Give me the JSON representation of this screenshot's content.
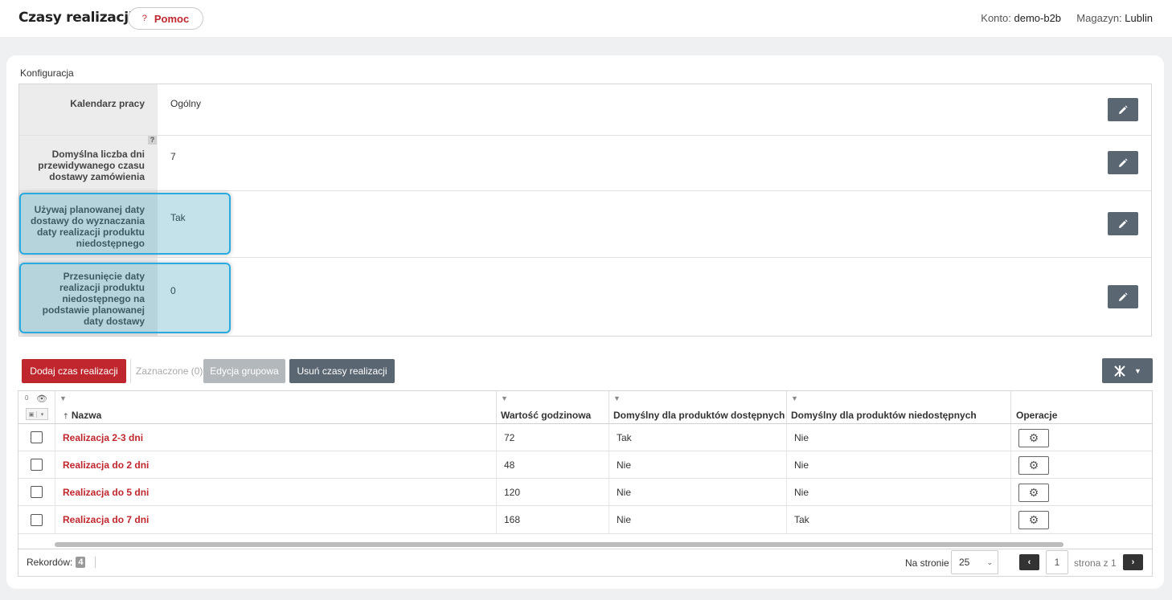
{
  "header": {
    "title": "Czasy realizacji",
    "help_label": "Pomoc",
    "help_icon": "?",
    "account_label": "Konto:",
    "account_value": "demo-b2b",
    "warehouse_label": "Magazyn:",
    "warehouse_value": "Lublin"
  },
  "config": {
    "section_label": "Konfiguracja",
    "help_marker": "?",
    "rows": [
      {
        "label": "Kalendarz pracy",
        "value": "Ogólny"
      },
      {
        "label": "Domyślna liczba dni przewidywanego czasu dostawy zamówienia",
        "value": "7"
      },
      {
        "label": "Używaj planowanej daty dostawy do wyznaczania daty realizacji produktu niedostępnego",
        "value": "Tak"
      },
      {
        "label": "Przesunięcie daty realizacji produktu niedostępnego na podstawie planowanej daty dostawy",
        "value": "0"
      }
    ]
  },
  "toolbar": {
    "add_label": "Dodaj czas realizacji",
    "selected_label": "Zaznaczone (0)",
    "group_edit_label": "Edycja grupowa",
    "delete_label": "Usuń czasy realizacji"
  },
  "grid": {
    "visible_count": "0",
    "columns": {
      "name": "Nazwa",
      "hours": "Wartość godzinowa",
      "default_available": "Domyślny dla produktów dostępnych",
      "default_unavailable": "Domyślny dla produktów niedostępnych",
      "operations": "Operacje"
    },
    "rows": [
      {
        "name": "Realizacja 2-3 dni",
        "hours": "72",
        "default_available": "Tak",
        "default_unavailable": "Nie"
      },
      {
        "name": "Realizacja do 2 dni",
        "hours": "48",
        "default_available": "Nie",
        "default_unavailable": "Nie"
      },
      {
        "name": "Realizacja do 5 dni",
        "hours": "120",
        "default_available": "Nie",
        "default_unavailable": "Nie"
      },
      {
        "name": "Realizacja do 7 dni",
        "hours": "168",
        "default_available": "Nie",
        "default_unavailable": "Tak"
      }
    ],
    "footer": {
      "records_label": "Rekordów:",
      "records_count": "4",
      "per_page_label": "Na stronie",
      "per_page_value": "25",
      "page_value": "1",
      "page_of": "strona z 1"
    }
  },
  "colors": {
    "accent": "#c0262d",
    "dark_button": "#5b6673",
    "highlight": "#29abe2"
  }
}
